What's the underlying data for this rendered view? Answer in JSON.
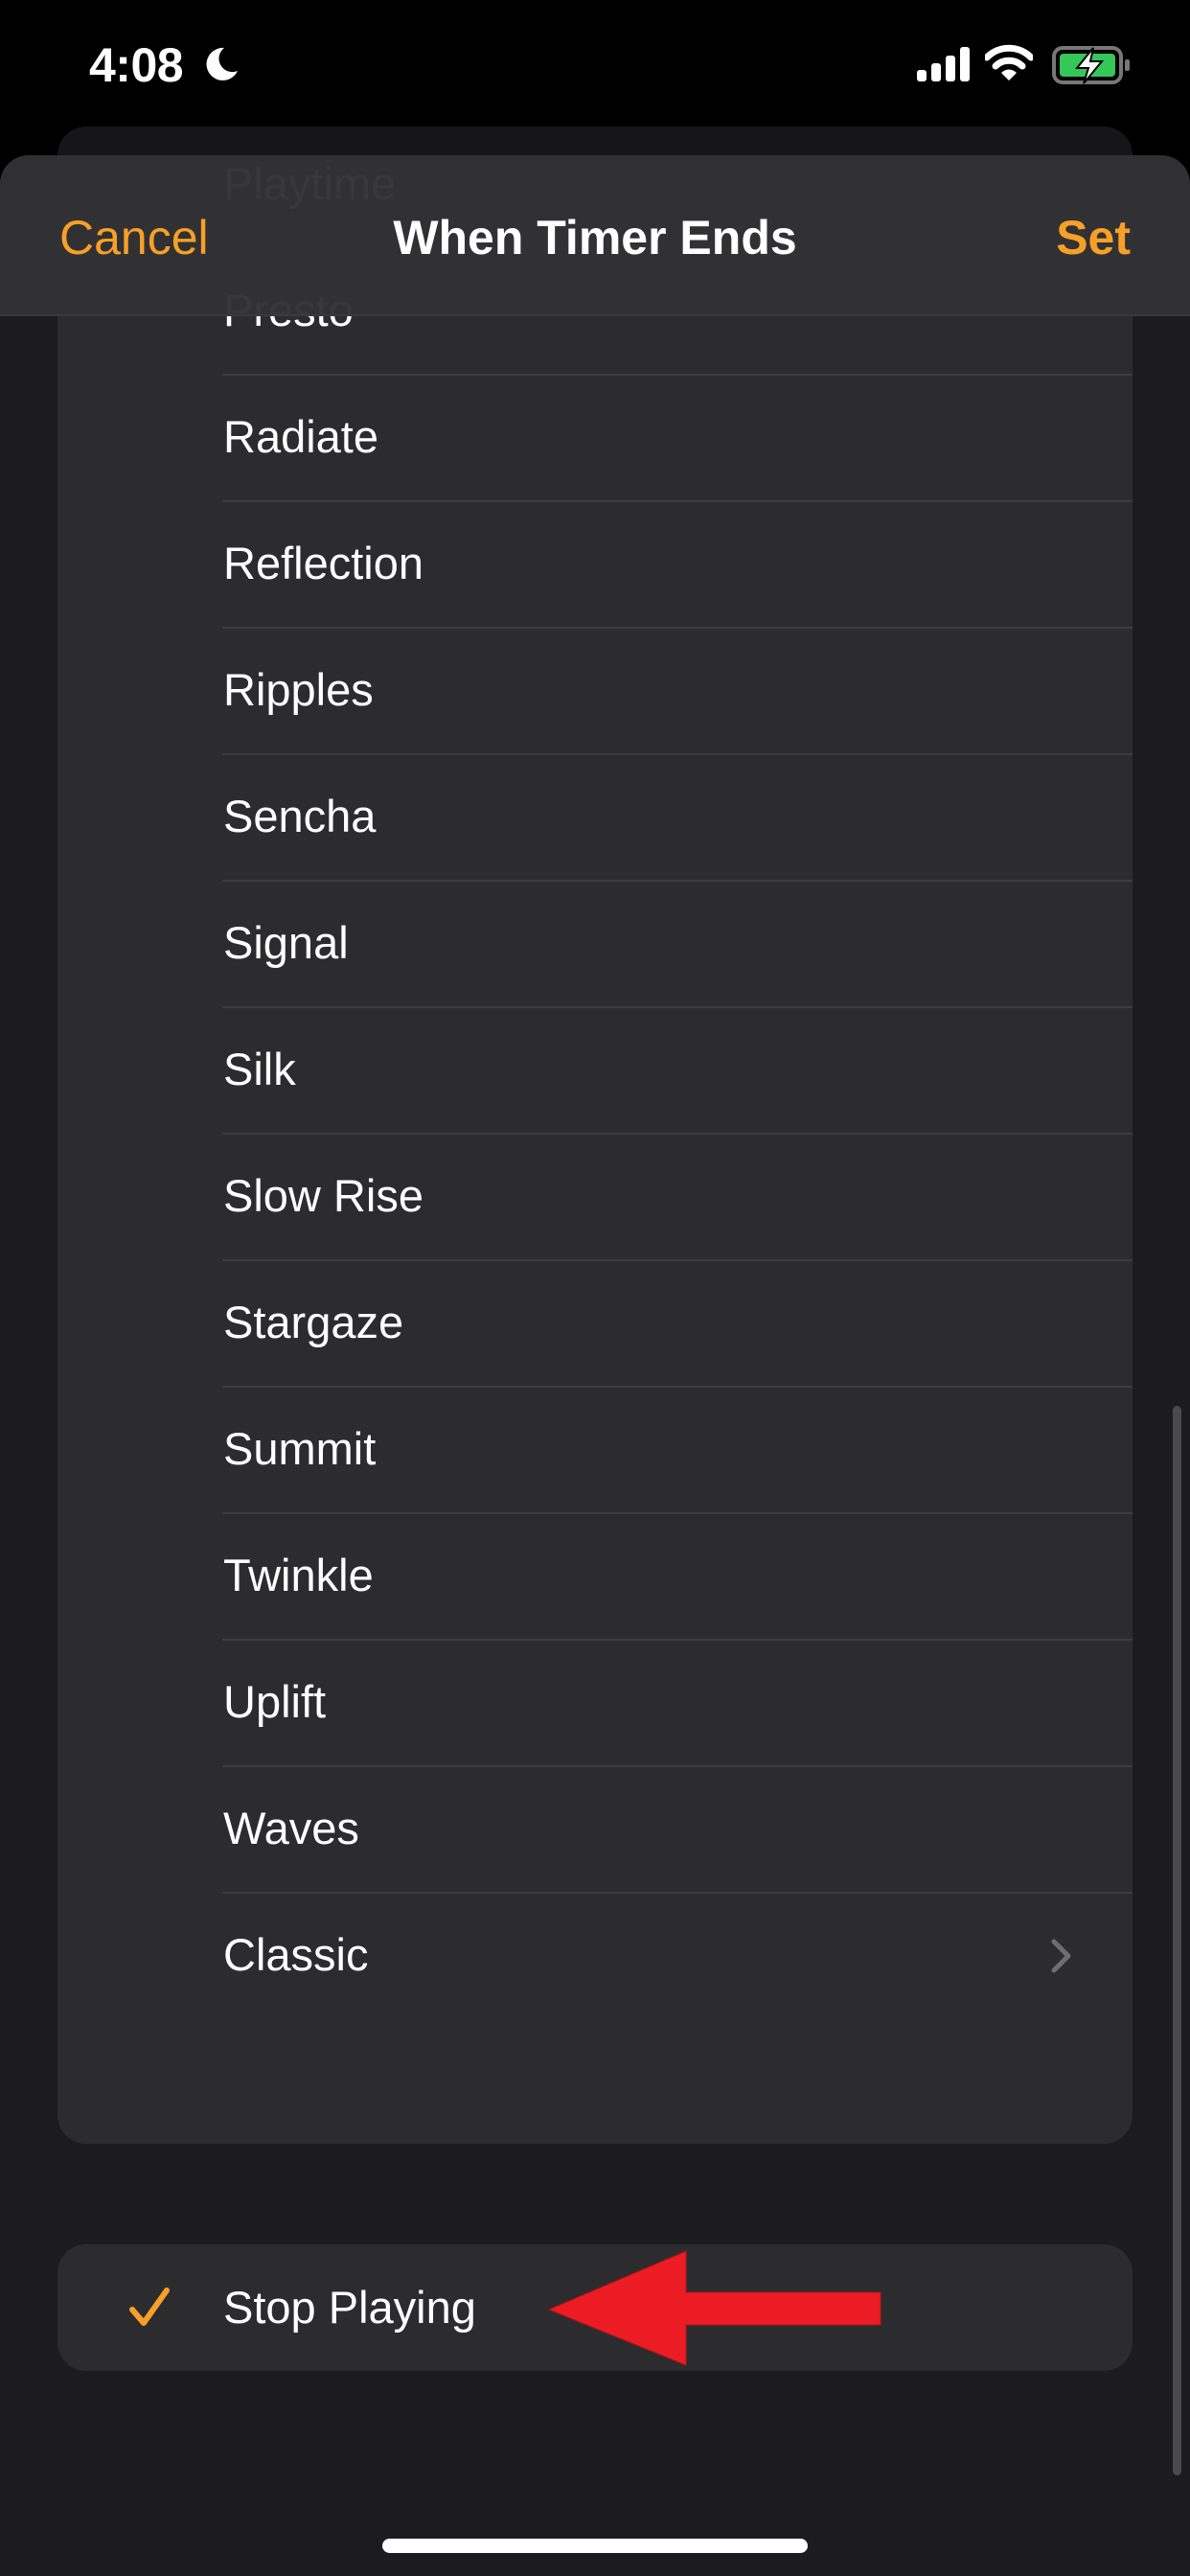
{
  "status_bar": {
    "time": "4:08",
    "focus_icon": "moon-icon",
    "signal_icon": "cellular-signal-icon",
    "wifi_icon": "wifi-icon",
    "battery_icon": "battery-charging-icon",
    "battery_color": "#34c759"
  },
  "nav": {
    "cancel_label": "Cancel",
    "title": "When Timer Ends",
    "set_label": "Set",
    "accent_color": "#f7a028"
  },
  "ringtones": {
    "items": [
      {
        "label": "Playtime"
      },
      {
        "label": "Presto"
      },
      {
        "label": "Radiate"
      },
      {
        "label": "Reflection"
      },
      {
        "label": "Ripples"
      },
      {
        "label": "Sencha"
      },
      {
        "label": "Signal"
      },
      {
        "label": "Silk"
      },
      {
        "label": "Slow Rise"
      },
      {
        "label": "Stargaze"
      },
      {
        "label": "Summit"
      },
      {
        "label": "Twinkle"
      },
      {
        "label": "Uplift"
      },
      {
        "label": "Waves"
      },
      {
        "label": "Classic",
        "has_chevron": true
      }
    ]
  },
  "stop_playing": {
    "label": "Stop Playing",
    "selected": true
  },
  "annotation": {
    "type": "red-arrow",
    "color": "#ec1c24",
    "points_to": "Stop Playing"
  }
}
